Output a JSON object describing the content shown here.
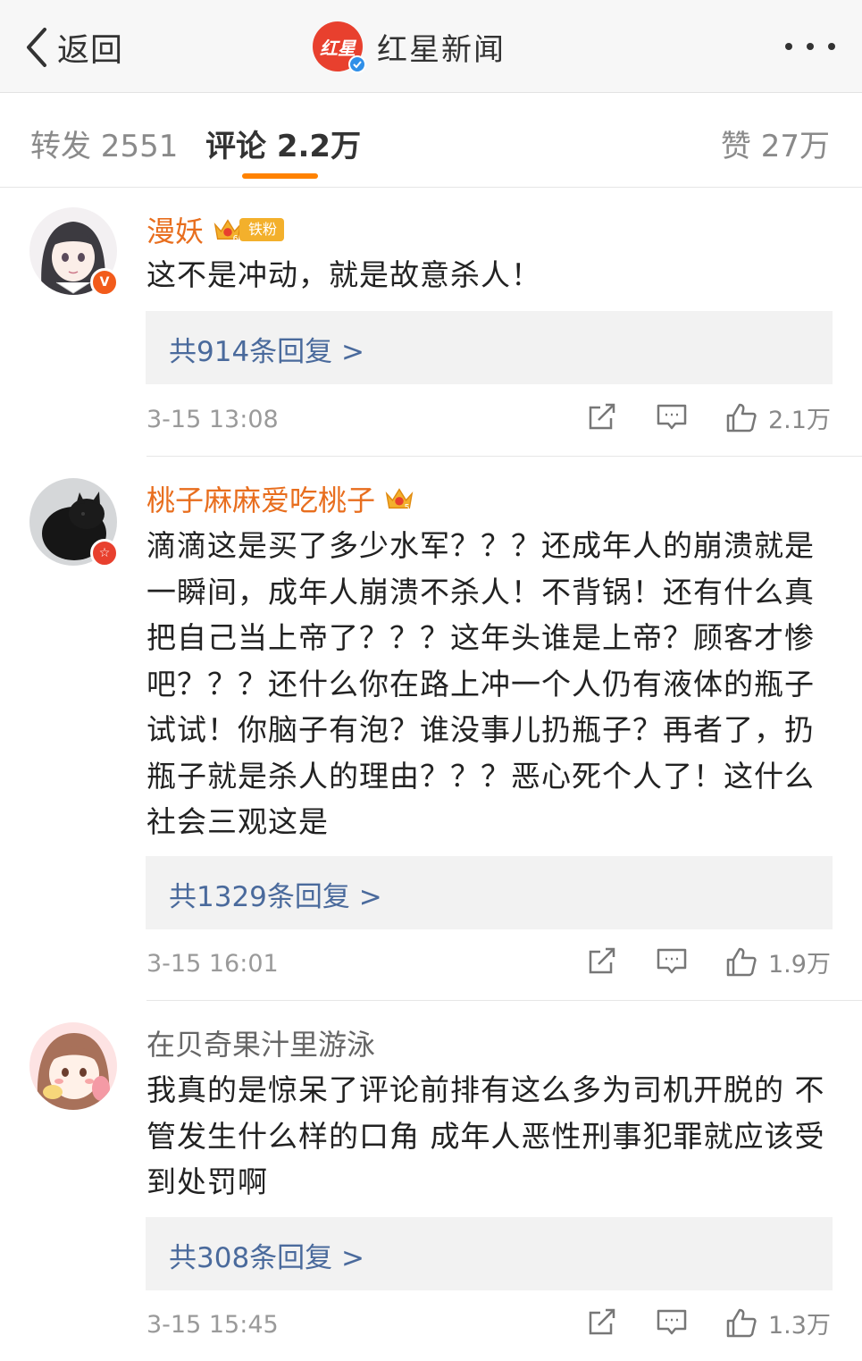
{
  "navbar": {
    "back_label": "返回",
    "logo_text": "红星",
    "title": "红星新闻"
  },
  "tabs": {
    "repost_label": "转发 2551",
    "comments_label": "评论 2.2万",
    "likes_label": "赞 27万",
    "active": "comments"
  },
  "colors": {
    "accent": "#ff8200",
    "username_member": "#e86e1e",
    "reply_link": "#4a6a9c",
    "logo_red": "#e8402e",
    "verified_blue": "#2f8fe8"
  },
  "comments": [
    {
      "username": "漫妖",
      "crown_level": "6",
      "fan_tag": "铁粉",
      "avatar_badge": "V",
      "text": "这不是冲动，就是故意杀人！",
      "replies_label": "共914条回复 >",
      "timestamp": "3-15 13:08",
      "like_count": "2.1万"
    },
    {
      "username": "桃子麻麻爱吃桃子",
      "crown_level": "5",
      "avatar_badge": "☆",
      "text": "滴滴这是买了多少水军？？？还成年人的崩溃就是一瞬间，成年人崩溃不杀人！不背锅！还有什么真把自己当上帝了？？？这年头谁是上帝？顾客才惨吧？？？还什么你在路上冲一个人仍有液体的瓶子试试！你脑子有泡？谁没事儿扔瓶子？再者了，扔瓶子就是杀人的理由？？？恶心死个人了！这什么社会三观这是",
      "replies_label": "共1329条回复 >",
      "timestamp": "3-15 16:01",
      "like_count": "1.9万"
    },
    {
      "username": "在贝奇果汁里游泳",
      "text": "我真的是惊呆了评论前排有这么多为司机开脱的 不管发生什么样的口角 成年人恶性刑事犯罪就应该受到处罚啊",
      "replies_label": "共308条回复 >",
      "timestamp": "3-15 15:45",
      "like_count": "1.3万"
    }
  ],
  "icons": {
    "back": "chevron-left-icon",
    "more": "more-dots-icon",
    "share": "repost-icon",
    "reply": "comment-icon",
    "like": "thumbs-up-icon",
    "crown": "crown-icon",
    "verified": "verified-check-icon"
  }
}
